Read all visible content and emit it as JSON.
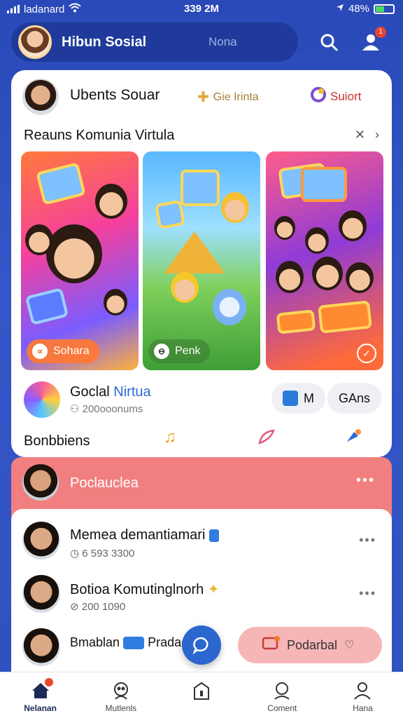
{
  "status_bar": {
    "carrier": "ladanard",
    "time": "339 2M",
    "battery": "48%",
    "battery_level": 0.48
  },
  "header": {
    "title": "Hibun Sosial",
    "mode_label": "Nona",
    "notification_count": "1"
  },
  "profile_card": {
    "name": "Ubents Souar",
    "feature_one": "Gie Irinta",
    "feature_two": "Suiort"
  },
  "community_section": {
    "title": "Reauns Komunia Virtula",
    "tiles": [
      {
        "chip": "Sohara",
        "chip_icon": "share-icon"
      },
      {
        "chip": "Penk",
        "chip_icon": "minus-circle-icon"
      },
      {
        "chip": "",
        "chip_icon": "check-circle-icon"
      }
    ]
  },
  "group": {
    "name_part1": "Goclal",
    "name_part2": "Nirtua",
    "meta": "200ooonums",
    "pill_one": "M",
    "pill_two": "GAns"
  },
  "categories": {
    "title": "Bonbbiens",
    "icons": [
      "music-note-icon",
      "feather-icon",
      "brush-icon"
    ]
  },
  "feed": {
    "highlight_title": "Poclauclea",
    "rows": [
      {
        "name": "Memea demantiamari",
        "meta": "6 593 3300"
      },
      {
        "name": "Botioa Komutinglnorh",
        "meta": "200 1090"
      },
      {
        "name": "Bmablan",
        "tag": "Pradac"
      }
    ]
  },
  "action_button": {
    "label": "Podarbal"
  },
  "bottom_nav": [
    {
      "label": "Nelanan",
      "icon": "home-icon",
      "active": true
    },
    {
      "label": "Mutlenls",
      "icon": "people-icon",
      "active": false
    },
    {
      "label": "",
      "icon": "building-icon",
      "active": false
    },
    {
      "label": "Coment",
      "icon": "chat-person-icon",
      "active": false
    },
    {
      "label": "Hana",
      "icon": "profile-icon",
      "active": false
    }
  ],
  "colors": {
    "background_blue": "#2f50c0",
    "accent_blue": "#2c67d0",
    "highlight_red": "#f27f7f",
    "action_pink": "#f7b6b6"
  }
}
